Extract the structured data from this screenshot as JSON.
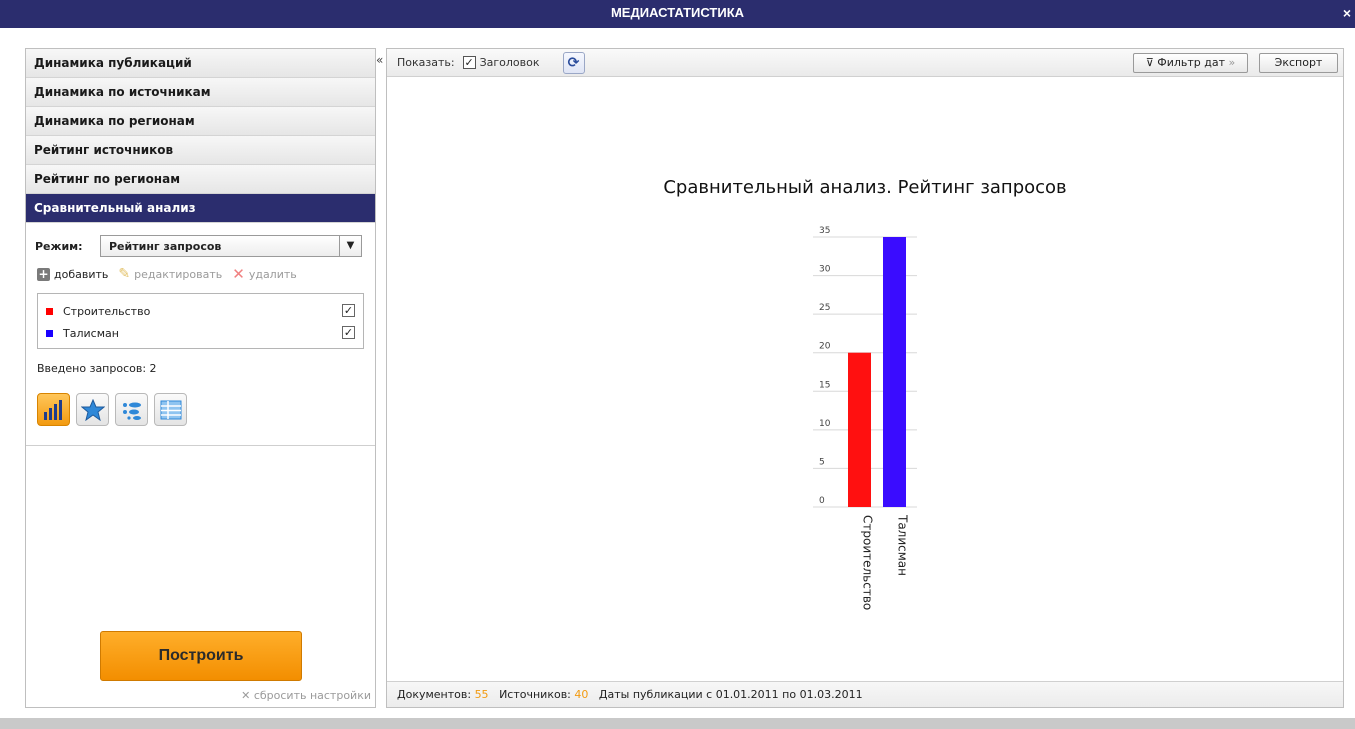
{
  "window": {
    "title": "МЕДИАСТАТИСТИКА",
    "close": "×"
  },
  "sidebar": {
    "sections": [
      {
        "label": "Динамика публикаций"
      },
      {
        "label": "Динамика по источникам"
      },
      {
        "label": "Динамика по регионам"
      },
      {
        "label": "Рейтинг источников"
      },
      {
        "label": "Рейтинг по регионам"
      },
      {
        "label": "Сравнительный анализ"
      }
    ],
    "active_section": 5,
    "mode_label": "Режим:",
    "mode_value": "Рейтинг запросов",
    "actions": {
      "add": "добавить",
      "edit": "редактировать",
      "delete": "удалить"
    },
    "queries": [
      {
        "label": "Строительство",
        "color": "#ff0000",
        "checked": "✓"
      },
      {
        "label": "Талисман",
        "color": "#1a00ff",
        "checked": "✓"
      }
    ],
    "count_text": "Введено запросов: 2",
    "views": [
      "bar-chart-icon",
      "star-chart-icon",
      "bubble-chart-icon",
      "table-icon"
    ],
    "build_label": "Построить",
    "reset_label": "сбросить настройки"
  },
  "toolbar": {
    "show_label": "Показать:",
    "header_checkbox": "✓",
    "header_label": "Заголовок",
    "date_filter_label": "Фильтр дат",
    "export_label": "Экспорт"
  },
  "chart_data": {
    "type": "bar",
    "title": "Сравнительный анализ. Рейтинг запросов",
    "categories": [
      "Строительство",
      "Талисман"
    ],
    "values": [
      20,
      35
    ],
    "colors": [
      "#ff1010",
      "#3a0cff"
    ],
    "ylim": [
      0,
      35
    ],
    "yticks": [
      0,
      5,
      10,
      15,
      20,
      25,
      30,
      35
    ],
    "grid": true
  },
  "status": {
    "docs_label": "Документов:",
    "docs_value": "55",
    "sources_label": "Источников:",
    "sources_value": "40",
    "dates_text": "Даты публикации с 01.01.2011 по 01.03.2011"
  }
}
